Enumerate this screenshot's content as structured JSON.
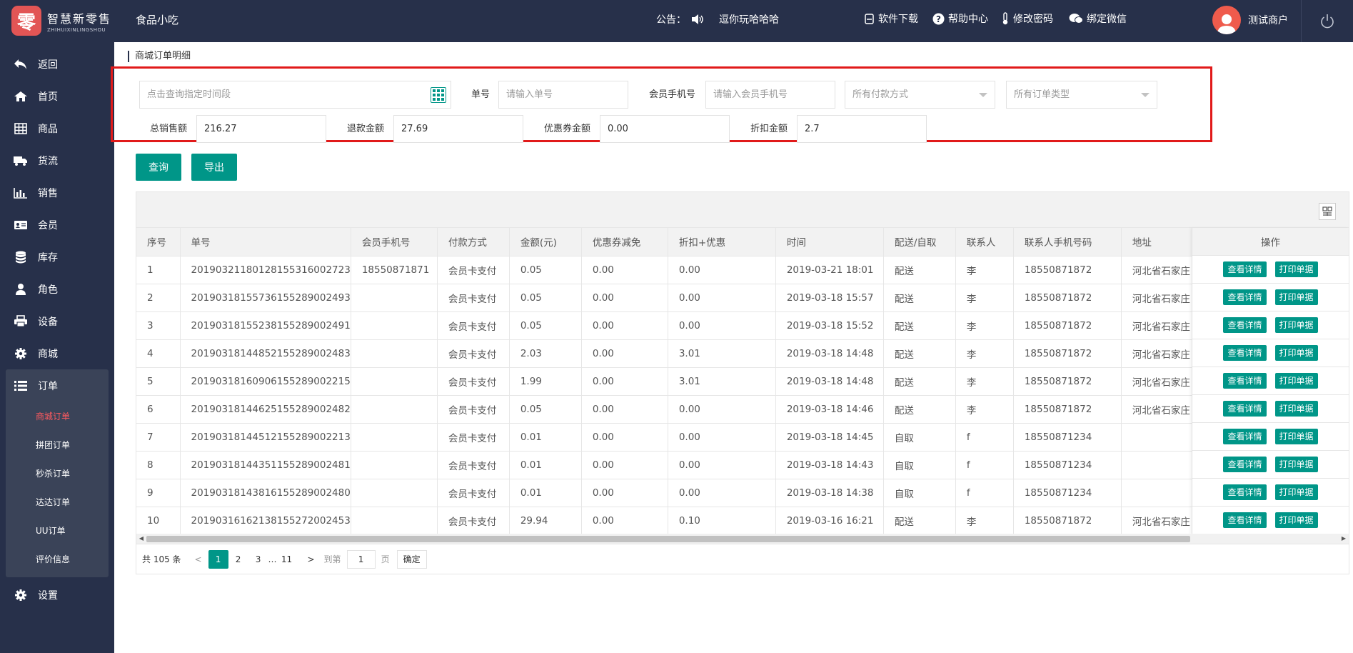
{
  "header": {
    "logo_char": "零",
    "brand_cn": "智慧新零售",
    "brand_en": "ZHIHUIXINLINGSHOU",
    "store_name": "食品小吃",
    "notice_label": "公告：",
    "notice_text": "逗你玩哈哈哈",
    "links": [
      "软件下载",
      "帮助中心",
      "修改密码",
      "绑定微信"
    ],
    "user_name": "测试商户"
  },
  "sidebar": {
    "items": [
      "返回",
      "首页",
      "商品",
      "货流",
      "销售",
      "会员",
      "库存",
      "角色",
      "设备",
      "商城",
      "订单"
    ],
    "sub_items": [
      "商城订单",
      "拼团订单",
      "秒杀订单",
      "达达订单",
      "UU订单",
      "评价信息"
    ],
    "settings": "设置"
  },
  "breadcrumb": "商城订单明细",
  "filters": {
    "date_placeholder": "点击查询指定时间段",
    "order_no_label": "单号",
    "order_no_placeholder": "请输入单号",
    "phone_label": "会员手机号",
    "phone_placeholder": "请输入会员手机号",
    "payment_select": "所有付款方式",
    "type_select": "所有订单类型",
    "total_sales_label": "总销售额",
    "total_sales": "216.27",
    "refund_label": "退款金额",
    "refund": "27.69",
    "coupon_label": "优惠券金额",
    "coupon": "0.00",
    "discount_label": "折扣金额",
    "discount": "2.7"
  },
  "buttons": {
    "query": "查询",
    "export": "导出"
  },
  "table": {
    "headers": [
      "序号",
      "单号",
      "会员手机号",
      "付款方式",
      "金额(元)",
      "优惠券减免",
      "折扣+优惠",
      "时间",
      "配送/自取",
      "联系人",
      "联系人手机号码",
      "地址"
    ],
    "op_header": "操作",
    "view_label": "查看详情",
    "print_label": "打印单据",
    "rows": [
      [
        "1",
        "20190321180128155316002723",
        "18550871871",
        "会员卡支付",
        "0.05",
        "0.00",
        "0.00",
        "2019-03-21 18:01",
        "配送",
        "李",
        "18550871872",
        "河北省石家庄"
      ],
      [
        "2",
        "20190318155736155289002493",
        "",
        "会员卡支付",
        "0.05",
        "0.00",
        "0.00",
        "2019-03-18 15:57",
        "配送",
        "李",
        "18550871872",
        "河北省石家庄"
      ],
      [
        "3",
        "20190318155238155289002491",
        "",
        "会员卡支付",
        "0.05",
        "0.00",
        "0.00",
        "2019-03-18 15:52",
        "配送",
        "李",
        "18550871872",
        "河北省石家庄"
      ],
      [
        "4",
        "20190318144852155289002483",
        "",
        "会员卡支付",
        "2.03",
        "0.00",
        "3.01",
        "2019-03-18 14:48",
        "配送",
        "李",
        "18550871872",
        "河北省石家庄"
      ],
      [
        "5",
        "20190318160906155289002215",
        "",
        "会员卡支付",
        "1.99",
        "0.00",
        "3.01",
        "2019-03-18 14:48",
        "配送",
        "李",
        "18550871872",
        "河北省石家庄"
      ],
      [
        "6",
        "20190318144625155289002482",
        "",
        "会员卡支付",
        "0.05",
        "0.00",
        "0.00",
        "2019-03-18 14:46",
        "配送",
        "李",
        "18550871872",
        "河北省石家庄"
      ],
      [
        "7",
        "20190318144512155289002213",
        "",
        "会员卡支付",
        "0.01",
        "0.00",
        "0.00",
        "2019-03-18 14:45",
        "自取",
        "f",
        "18550871234",
        ""
      ],
      [
        "8",
        "20190318144351155289002481",
        "",
        "会员卡支付",
        "0.01",
        "0.00",
        "0.00",
        "2019-03-18 14:43",
        "自取",
        "f",
        "18550871234",
        ""
      ],
      [
        "9",
        "20190318143816155289002480",
        "",
        "会员卡支付",
        "0.01",
        "0.00",
        "0.00",
        "2019-03-18 14:38",
        "自取",
        "f",
        "18550871234",
        ""
      ],
      [
        "10",
        "20190316162138155272002453",
        "",
        "会员卡支付",
        "29.94",
        "0.00",
        "0.10",
        "2019-03-16 16:21",
        "配送",
        "李",
        "18550871872",
        "河北省石家庄"
      ]
    ]
  },
  "pagination": {
    "total": "共 105 条",
    "pages": [
      "1",
      "2",
      "3"
    ],
    "ellipsis": "…",
    "last": "11",
    "goto_label": "到第",
    "goto_value": "1",
    "page_unit": "页",
    "confirm": "确定"
  }
}
